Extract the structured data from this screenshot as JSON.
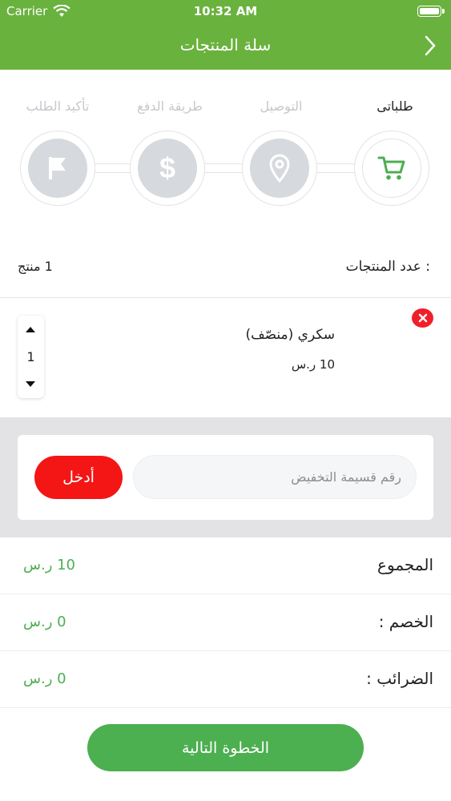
{
  "status_bar": {
    "carrier": "Carrier",
    "time": "10:32 AM"
  },
  "header": {
    "title": "سلة المنتجات",
    "back_icon": "chevron-right-icon"
  },
  "steps": [
    {
      "label": "طلباتى",
      "icon": "cart-icon",
      "active": true
    },
    {
      "label": "التوصيل",
      "icon": "location-pin-icon",
      "active": false
    },
    {
      "label": "طريقة الدفع",
      "icon": "dollar-icon",
      "active": false
    },
    {
      "label": "تأكيد الطلب",
      "icon": "flag-icon",
      "active": false
    }
  ],
  "cart_summary": {
    "label": "عدد المنتجات :",
    "value": "1 منتج"
  },
  "product": {
    "name": "سكري (منصّف)",
    "price": "10 ر.س",
    "quantity": "1"
  },
  "coupon": {
    "placeholder": "رقم قسيمة التخفيض",
    "button": "أدخل"
  },
  "totals": [
    {
      "label": "المجموع",
      "value": "10 ر.س"
    },
    {
      "label": "الخصم :",
      "value": "0 ر.س"
    },
    {
      "label": "الضرائب :",
      "value": "0 ر.س"
    }
  ],
  "next_button": "الخطوة التالية",
  "colors": {
    "primary_green": "#6ab23e",
    "button_green": "#4caf50",
    "danger_red": "#f41515",
    "inactive_gray": "#d6d9dd"
  }
}
